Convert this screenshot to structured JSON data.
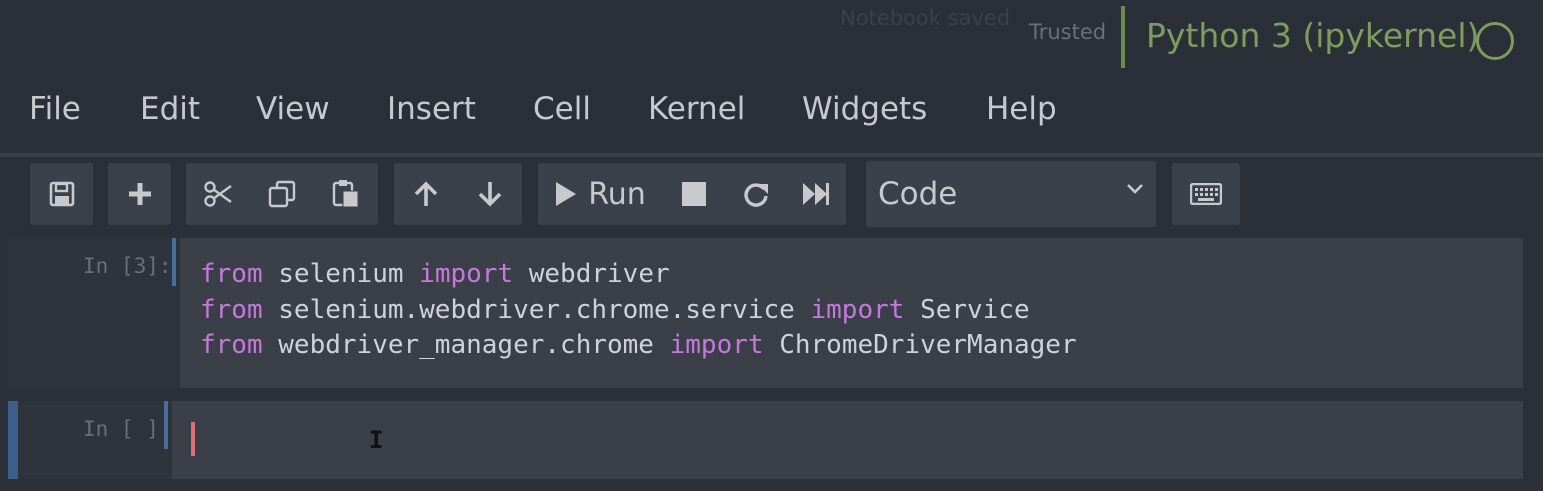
{
  "header": {
    "save_status": "Notebook saved",
    "trust_status": "Trusted",
    "kernel_name": "Python 3 (ipykernel)"
  },
  "menubar": {
    "items": [
      "File",
      "Edit",
      "View",
      "Insert",
      "Cell",
      "Kernel",
      "Widgets",
      "Help"
    ]
  },
  "toolbar": {
    "icons": [
      "save-icon",
      "plus-icon",
      "scissors-icon",
      "copy-icon",
      "paste-icon",
      "arrow-up-icon",
      "arrow-down-icon",
      "play-icon",
      "stop-icon",
      "restart-icon",
      "fast-forward-icon",
      "keyboard-icon"
    ],
    "run_label": "Run",
    "cell_type_selected": "Code"
  },
  "cells": [
    {
      "prompt": "In [3]:",
      "lines": [
        {
          "kw1": "from",
          "mod": " selenium ",
          "kw2": "import",
          "name": " webdriver"
        },
        {
          "kw1": "from",
          "mod": " selenium.webdriver.chrome.service ",
          "kw2": "import",
          "name": " Service"
        },
        {
          "kw1": "from",
          "mod": " webdriver_manager.chrome ",
          "kw2": "import",
          "name": " ChromeDriverManager"
        }
      ]
    },
    {
      "prompt": "In [ ]:",
      "lines": []
    }
  ],
  "colors": {
    "keyword": "#c678dd",
    "kernel": "#7e9d5c",
    "cursor": "#e06c75",
    "cell_bar": "#4a6e9c"
  }
}
